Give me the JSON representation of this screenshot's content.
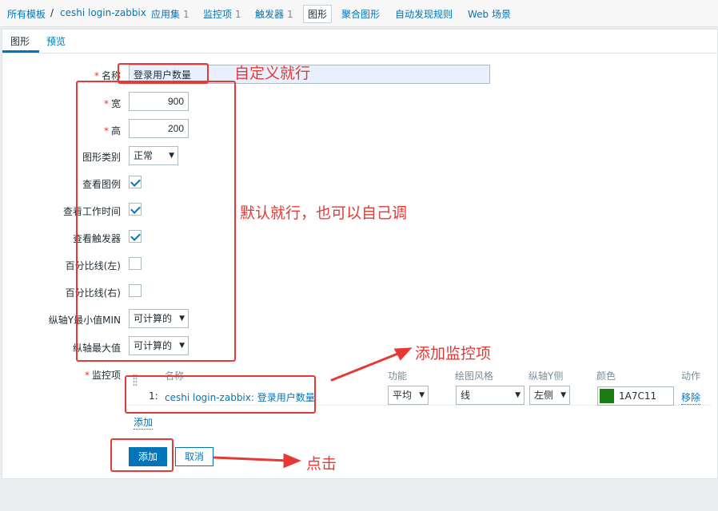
{
  "breadcrumb": {
    "all_templates": "所有模板",
    "separator": "/",
    "host": "ceshi login-zabbix",
    "applications": "应用集",
    "applications_count": "1",
    "items": "监控项",
    "items_count": "1",
    "triggers": "触发器",
    "triggers_count": "1",
    "graphs": "图形",
    "screens": "聚合图形",
    "discovery": "自动发现规则",
    "web": "Web 场景"
  },
  "tabs": {
    "graph": "图形",
    "preview": "预览"
  },
  "form": {
    "required_mark": "*",
    "name_label": "名称",
    "name_value": "登录用户数量",
    "width_label": "宽",
    "width_value": "900",
    "height_label": "高",
    "height_value": "200",
    "graph_type_label": "图形类别",
    "graph_type_value": "正常",
    "show_legend_label": "查看图例",
    "show_legend": true,
    "show_working_time_label": "查看工作时间",
    "show_working_time": true,
    "show_triggers_label": "查看触发器",
    "show_triggers": true,
    "percentile_left_label": "百分比线(左)",
    "percentile_left": false,
    "percentile_right_label": "百分比线(右)",
    "percentile_right": false,
    "ymin_label": "纵轴Y最小值MIN",
    "ymin_value": "可计算的",
    "ymax_label": "纵轴最大值",
    "ymax_value": "可计算的",
    "items_label": "监控项"
  },
  "items_table": {
    "headers": {
      "name": "名称",
      "function": "功能",
      "draw_style": "绘图风格",
      "y_axis": "纵轴Y侧",
      "color": "颜色",
      "action": "动作"
    },
    "rows": [
      {
        "index": "1:",
        "name": "ceshi login-zabbix: 登录用户数量",
        "function": "平均",
        "draw_style": "线",
        "y_axis": "左侧",
        "color": "1A7C11",
        "color_hex": "#1a7c11",
        "action": "移除"
      }
    ],
    "add_link": "添加"
  },
  "buttons": {
    "add": "添加",
    "cancel": "取消"
  },
  "annotations": {
    "custom": "自定义就行",
    "default_ok": "默认就行，也可以自己调",
    "add_item": "添加监控项",
    "click": "点击",
    "color": "#e53935"
  }
}
